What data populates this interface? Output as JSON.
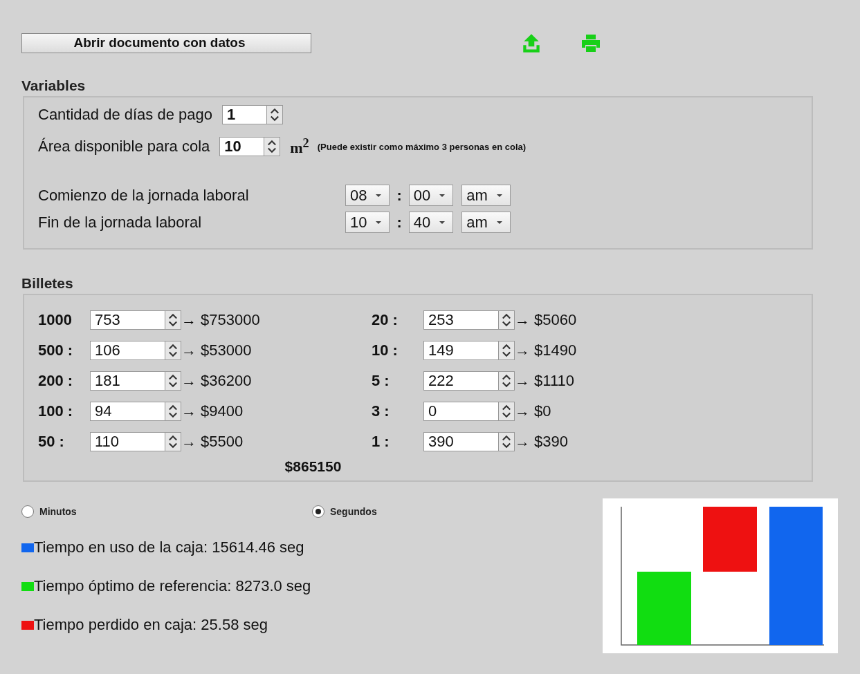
{
  "open_button": "Abrir documento con datos",
  "variables": {
    "title": "Variables",
    "payment_days": {
      "label": "Cantidad de días de pago",
      "value": "1"
    },
    "queue_area": {
      "label": "Área disponible para cola",
      "value": "10",
      "unit": "m$^{2}$",
      "note": "(Puede existir como máximo 3 personas en cola)"
    },
    "times": [
      {
        "label": "Comienzo de la jornada laboral",
        "hour": "08",
        "separator": ":",
        "minute": "00",
        "period": "am"
      },
      {
        "label": "Fin de la jornada laboral",
        "hour": "10",
        "separator": ":",
        "minute": "40",
        "period": "am"
      }
    ]
  },
  "bills": {
    "title": "Billetes",
    "columns": [
      [
        {
          "label": "1000",
          "value": "753",
          "result": "→ $753000"
        },
        {
          "label": "500 :",
          "value": "106",
          "result": "→ $53000"
        },
        {
          "label": "200 :",
          "value": "181",
          "result": "→ $36200"
        },
        {
          "label": "100 :",
          "value": "94",
          "result": "→ $9400"
        },
        {
          "label": "50 :",
          "value": "110",
          "result": "→ $5500"
        }
      ],
      [
        {
          "label": "20 :",
          "value": "253",
          "result": "→ $5060"
        },
        {
          "label": "10 :",
          "value": "149",
          "result": "→ $1490"
        },
        {
          "label": "5 :",
          "value": "222",
          "result": "→ $1110"
        },
        {
          "label": "3 :",
          "value": "0",
          "result": "→ $0"
        },
        {
          "label": "1 :",
          "value": "390",
          "result": "→ $390"
        }
      ]
    ],
    "total": "$865150"
  },
  "units": [
    {
      "label": "Minutos",
      "selected": false
    },
    {
      "label": "Segundos",
      "selected": true
    }
  ],
  "legend": [
    {
      "text": "Tiempo en uso de la caja: 15614.46 seg",
      "color": "#1166ee"
    },
    {
      "text": "Tiempo óptimo de referencia: 8273.0 seg",
      "color": "#11dd11"
    },
    {
      "text": "Tiempo perdido en caja: 25.58 seg",
      "color": "#ee1111"
    }
  ]
}
